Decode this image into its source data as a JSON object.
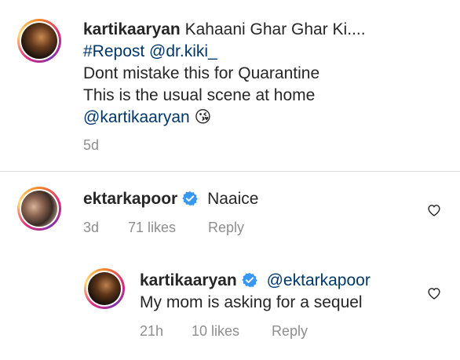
{
  "caption": {
    "username": "kartikaaryan",
    "line1": "Kahaani Ghar Ghar Ki....",
    "line2": "#Repost @dr.kiki_",
    "line3": "Dont mistake this for Quarantine",
    "line4": "This is the usual scene at home",
    "mention": "@kartikaaryan",
    "emoji": "😘",
    "time": "5d"
  },
  "comment1": {
    "username": "ektarkapoor",
    "text": "Naaice",
    "time": "3d",
    "likes": "71 likes",
    "reply": "Reply"
  },
  "reply1": {
    "username": "kartikaaryan",
    "mention": "@ektarkapoor",
    "text": "My mom is asking for a sequel",
    "time": "21h",
    "likes": "10 likes",
    "reply": "Reply"
  },
  "colors": {
    "link": "#00376b",
    "verified": "#3897f0",
    "meta": "#8e8e8e"
  }
}
